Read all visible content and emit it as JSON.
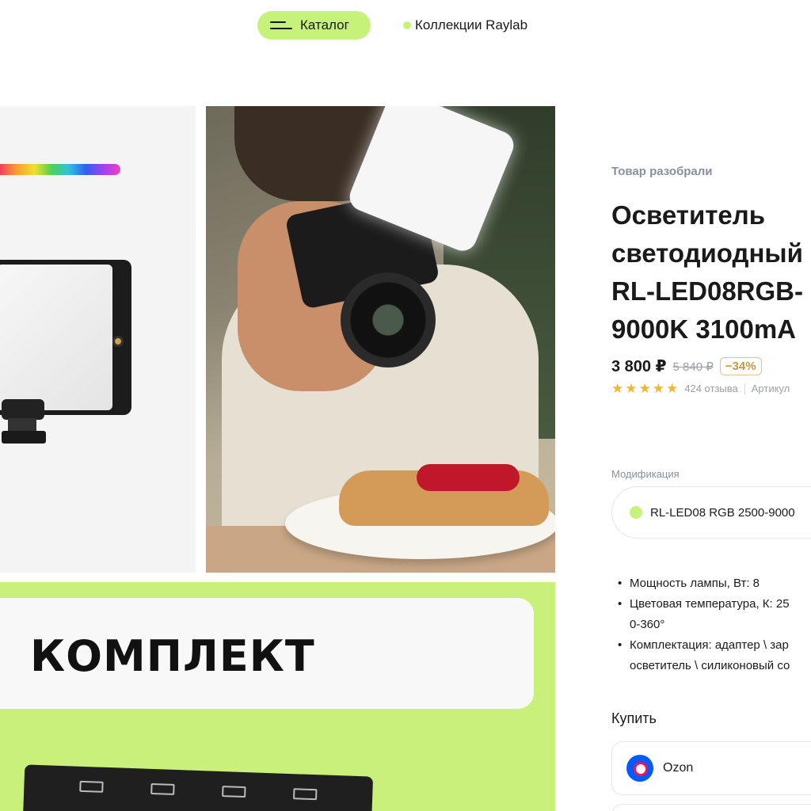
{
  "nav": {
    "catalog_label": "Каталог",
    "collections_label": "Коллекции Raylab"
  },
  "gallery": {
    "banner_title": "КОМПЛЕКТ"
  },
  "product": {
    "brand_note": "Товар разобрали",
    "title_lines": [
      "Осветитель",
      "светодиодный",
      "RL-LED08RGB-",
      "9000K 3100mA"
    ],
    "price_current": "3 800 ₽",
    "price_old": "5 840 ₽",
    "discount": "−34%",
    "rating_stars": 5,
    "reviews": "424 отзыва",
    "article_label": "Артикул"
  },
  "modification": {
    "label": "Модификация",
    "selected": "RL-LED08 RGB 2500-9000"
  },
  "specs": {
    "power": "Мощность лампы, Вт: 8",
    "color_temp": "Цветовая температура, К: 25",
    "color_temp_cont": "0-360°",
    "kit": "Комплектация: адаптер \\ зар",
    "kit_cont": "осветитель \\ силиконовый со"
  },
  "buy": {
    "label": "Купить",
    "marketplace": "Ozon"
  },
  "colors": {
    "accent": "#c6f27a",
    "star": "#f0b730",
    "discount": "#c79a3a",
    "ozon_blue": "#005bff",
    "ozon_pink": "#f91155"
  },
  "icons": [
    "menu-icon",
    "star-icon",
    "ozon-logo-icon"
  ]
}
